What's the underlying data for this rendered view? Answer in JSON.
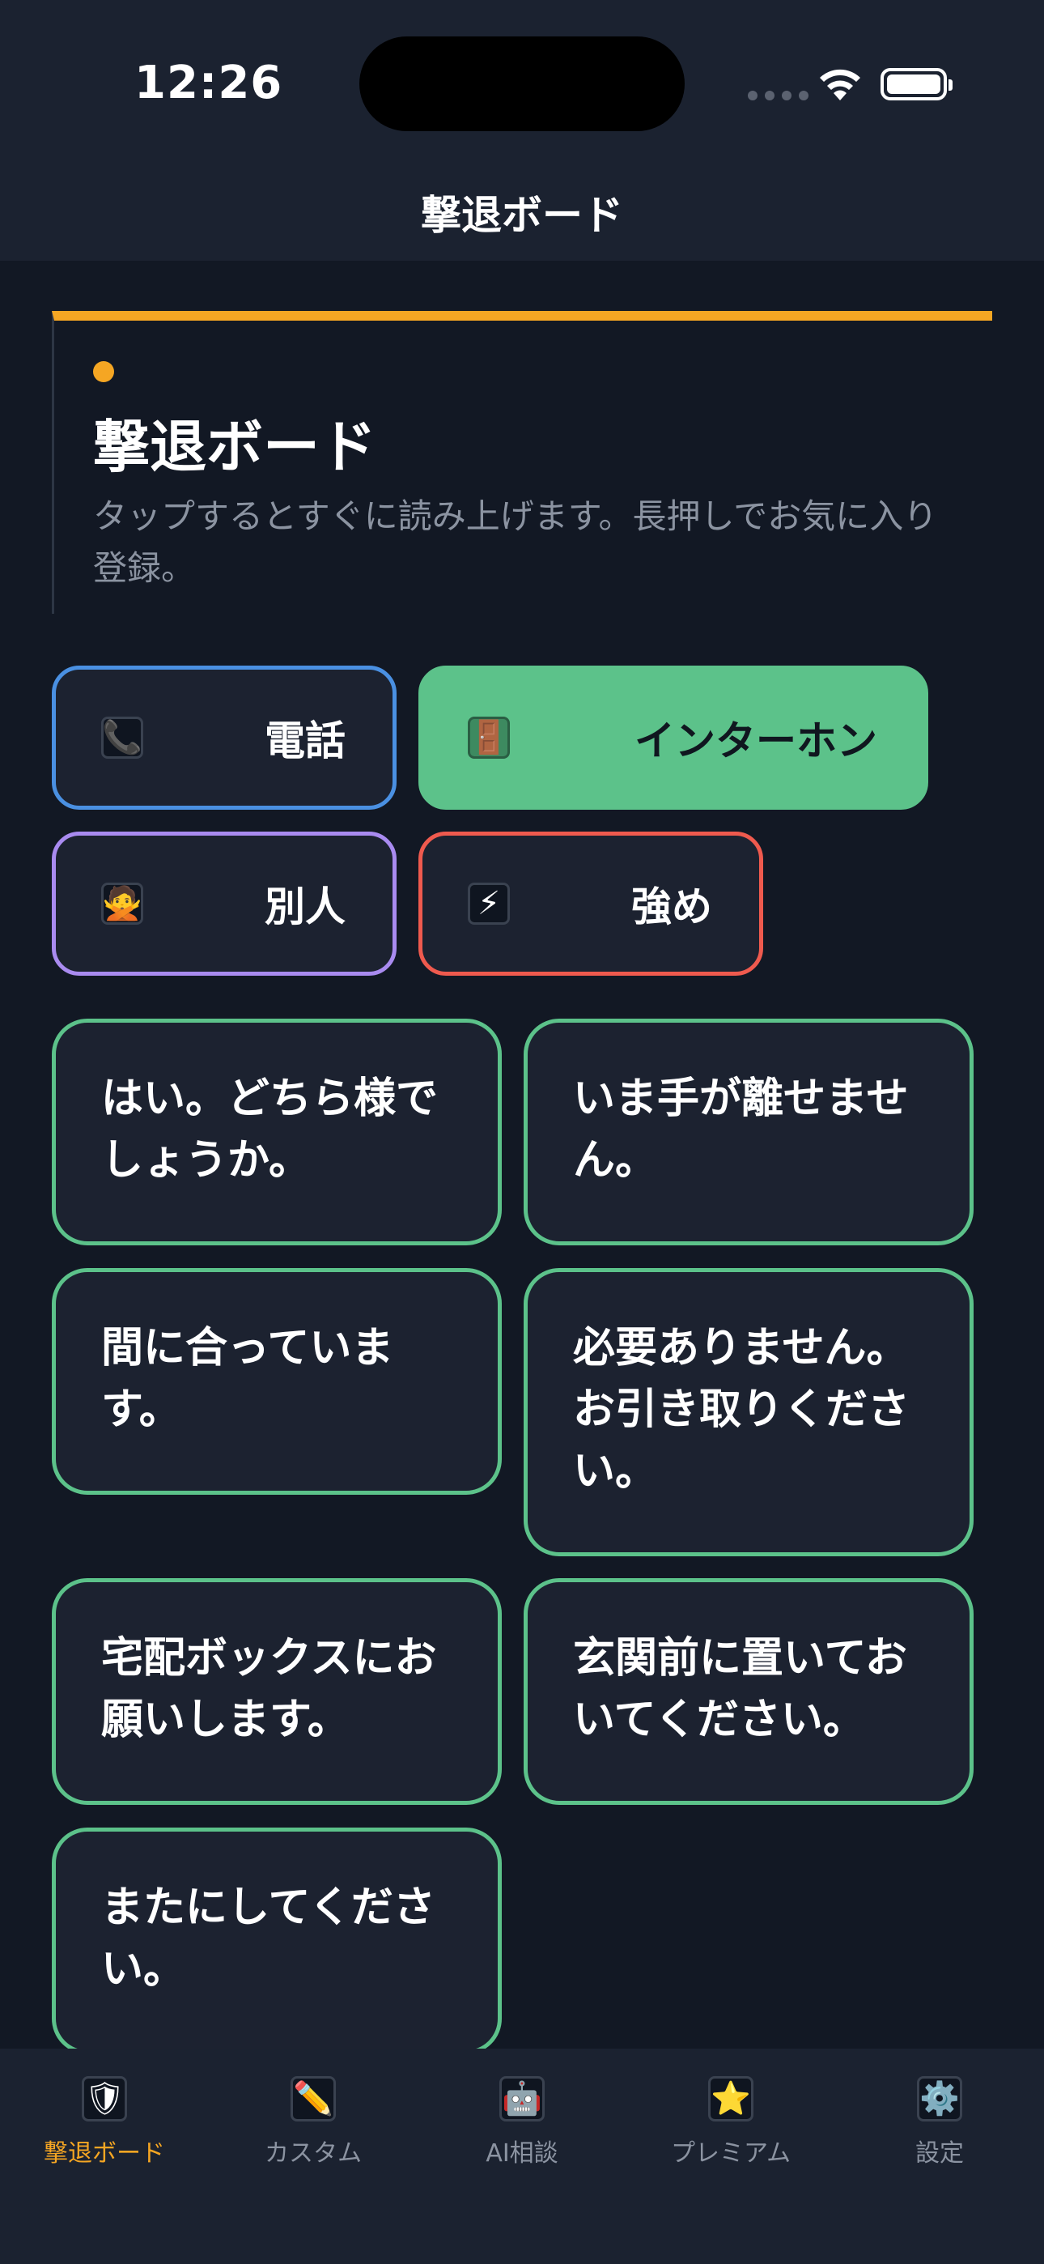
{
  "status_bar": {
    "time": "12:26"
  },
  "nav": {
    "title": "撃退ボード"
  },
  "header": {
    "title": "撃退ボード",
    "subtitle": "タップするとすぐに読み上げます。長押しでお気に入り登録。"
  },
  "categories": [
    {
      "label": "電話",
      "icon": "📞",
      "color": "#4a90e2"
    },
    {
      "label": "インターホン",
      "icon": "🚪",
      "color": "#5cc28a"
    },
    {
      "label": "別人",
      "icon": "🙅",
      "color": "#a98bf0"
    },
    {
      "label": "強め",
      "icon": "⚡",
      "color": "#ef5a4e"
    }
  ],
  "phrases": [
    "はい。どちら様でしょうか。",
    "いま手が離せません。",
    "間に合っています。",
    "必要ありません。お引き取りください。",
    "宅配ボックスにお願いします。",
    "玄関前に置いておいてください。",
    "またにしてください。"
  ],
  "tabs": [
    {
      "label": "撃退ボード",
      "icon": "🛡",
      "active": true
    },
    {
      "label": "カスタム",
      "icon": "✏️",
      "active": false
    },
    {
      "label": "AI相談",
      "icon": "🤖",
      "active": false
    },
    {
      "label": "プレミアム",
      "icon": "⭐",
      "active": false
    },
    {
      "label": "設定",
      "icon": "⚙️",
      "active": false
    }
  ],
  "colors": {
    "accent": "#f5a623",
    "background": "#121824",
    "card": "#1c2230",
    "phrase_border": "#5cc28a"
  }
}
